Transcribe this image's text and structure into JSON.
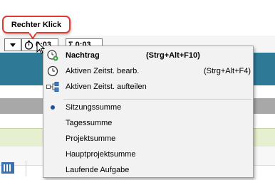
{
  "callout": {
    "label": "Rechter Klick"
  },
  "toolbar": {
    "timer_value": "0:03",
    "sum_value": "Σ 0:03"
  },
  "menu": {
    "items": [
      {
        "label": "Nachtrag",
        "shortcut": "(Strg+Alt+F10)",
        "icon": "clock-add-icon",
        "bold": true
      },
      {
        "label": "Aktiven Zeitst. bearb.",
        "shortcut": "(Strg+Alt+F4)",
        "icon": "clock-icon"
      },
      {
        "label": "Aktiven Zeitst. aufteilen",
        "shortcut": "",
        "icon": "split-icon"
      },
      {
        "label": "Sitzungssumme",
        "checked": true
      },
      {
        "label": "Tagessumme"
      },
      {
        "label": "Projektsumme"
      },
      {
        "label": "Hauptprojektsumme"
      },
      {
        "label": "Laufende Aufgabe"
      }
    ]
  },
  "colors": {
    "header": "#2e7a96",
    "accent": "#1e4f9a",
    "callout_border": "#e23a30"
  }
}
